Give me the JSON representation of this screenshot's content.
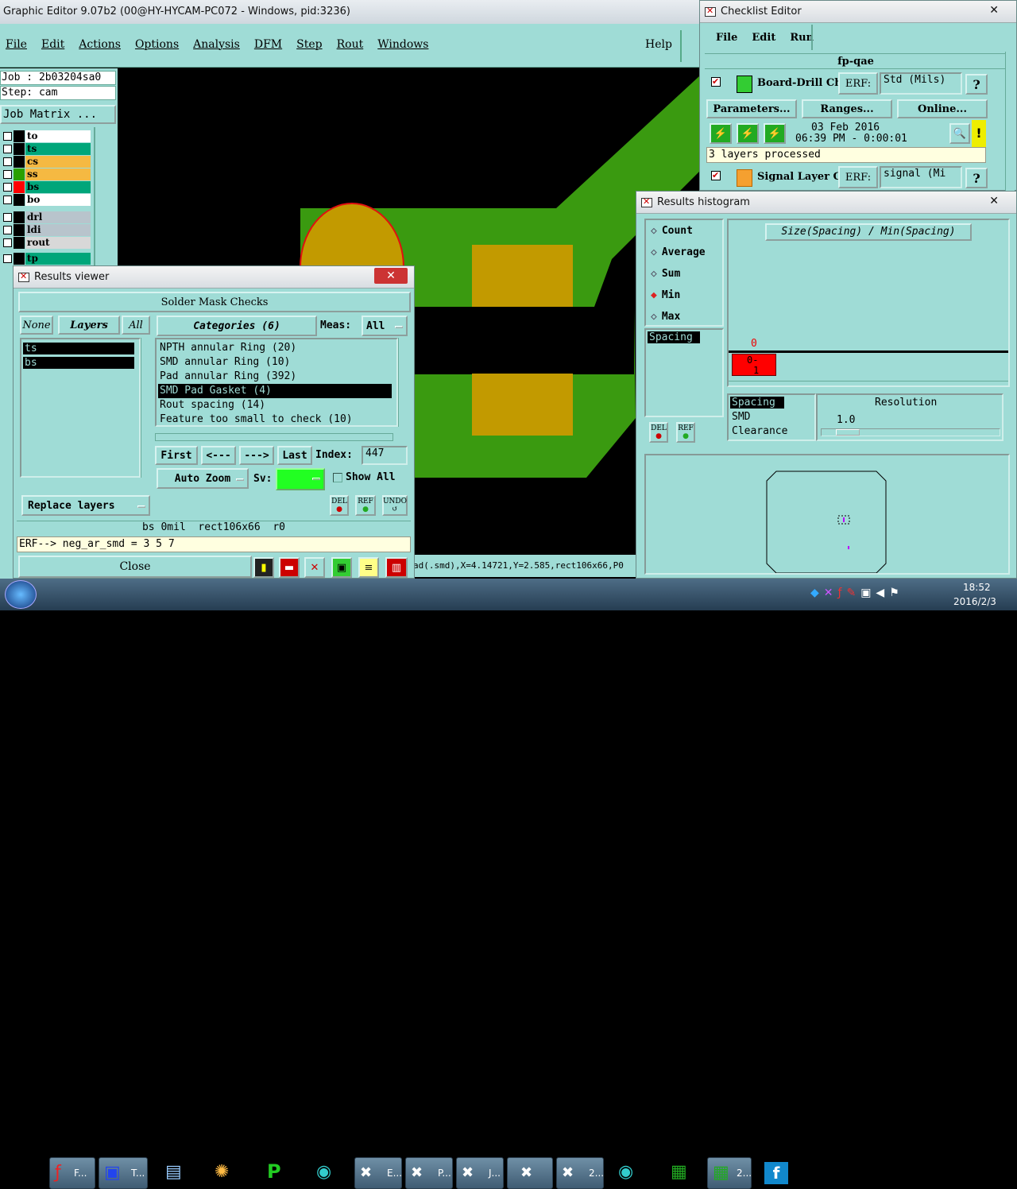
{
  "main_window": {
    "title": "Graphic Editor 9.07b2 (00@HY-HYCAM-PC072 - Windows, pid:3236)",
    "menu": [
      "File",
      "Edit",
      "Actions",
      "Options",
      "Analysis",
      "DFM",
      "Step",
      "Rout",
      "Windows"
    ],
    "help": "Help",
    "job_label": "Job : 2b03204sa0",
    "step_label": "Step: cam",
    "job_matrix": "Job Matrix ...",
    "layers": [
      {
        "name": "to",
        "color": "#ffffff",
        "swatch": "#000000"
      },
      {
        "name": "ts",
        "color": "#00a67a",
        "swatch": "#000000"
      },
      {
        "name": "cs",
        "color": "#f5b942",
        "swatch": "#000000"
      },
      {
        "name": "ss",
        "color": "#f5b942",
        "swatch": "#2aa000"
      },
      {
        "name": "bs",
        "color": "#00a67a",
        "swatch": "#ff0000"
      },
      {
        "name": "bo",
        "color": "#ffffff",
        "swatch": "#000000"
      },
      {
        "name": "drl",
        "color": "#b8c4cc",
        "swatch": "#000000"
      },
      {
        "name": "ldi",
        "color": "#b8c4cc",
        "swatch": "#000000"
      },
      {
        "name": "rout",
        "color": "#d8d8d8",
        "swatch": "#000000"
      },
      {
        "name": "tp",
        "color": "#00a67a",
        "swatch": "#000000"
      }
    ],
    "status_line": "ad(.smd),X=4.14721,Y=2.585,rect106x66,P0"
  },
  "results_viewer": {
    "title": "Results viewer",
    "header": "Solder Mask Checks",
    "none_btn": "None",
    "layers_btn": "Layers",
    "all_btn": "All",
    "categories_btn": "Categories (6)",
    "meas_label": "Meas:",
    "meas_value": "All",
    "layer_items": [
      "ts",
      "bs"
    ],
    "categories": [
      "NPTH annular Ring (20)",
      "SMD annular Ring (10)",
      "Pad annular Ring (392)",
      "SMD Pad Gasket (4)",
      "Rout spacing (14)",
      "Feature too small to check (10)"
    ],
    "selected_category": 3,
    "first_btn": "First",
    "prev_btn": "<---",
    "next_btn": "--->",
    "last_btn": "Last",
    "index_label": "Index:",
    "index_value": "447",
    "auto_zoom": "Auto Zoom",
    "sv_label": "Sv:",
    "show_all": "Show All",
    "replace_layers": "Replace layers",
    "del_label": "DEL",
    "ref_label": "REF",
    "undo_label": "UNDO",
    "info_line": "bs 0mil  rect106x66  r0",
    "erf_line": "ERF--> neg_ar_smd = 3 5 7",
    "close_btn": "Close"
  },
  "checklist_editor": {
    "title": "Checklist Editor",
    "menu": [
      "File",
      "Edit",
      "Run"
    ],
    "checklist_name": "fp-qae",
    "check1_name": "Board-Drill Che",
    "erf_label": "ERF:",
    "check1_erf": "Std (Mils)",
    "parameters_btn": "Parameters...",
    "ranges_btn": "Ranges...",
    "online_btn": "Online...",
    "date": "03 Feb 2016",
    "time": "06:39 PM - 0:00:01",
    "status": "3 layers processed",
    "check2_name": "Signal Layer Ch",
    "check2_erf": "signal (Mi"
  },
  "histogram": {
    "title": "Results histogram",
    "modes": [
      "Count",
      "Average",
      "Sum",
      "Min",
      "Max"
    ],
    "selected_mode": "Min",
    "graph_title": "Size(Spacing) / Min(Spacing)",
    "list_item": "Spacing",
    "bar_value": "0",
    "bar_label_top": "0-",
    "bar_label_bottom": "1",
    "measure_list": [
      "Spacing",
      "SMD",
      "Clearance"
    ],
    "resolution_label": "Resolution",
    "resolution_value": "1.0",
    "del_label": "DEL",
    "ref_label": "REF"
  },
  "taskbar": {
    "items": [
      "F...",
      "T...",
      "E...",
      "P...",
      "J...",
      "2...",
      "2..."
    ],
    "clock_time": "18:52",
    "clock_date": "2016/2/3"
  },
  "colors": {
    "panel": "#9fdcd6",
    "board_green": "#3a9a10",
    "pad_gold": "#c29a00",
    "selection": "#000000"
  }
}
